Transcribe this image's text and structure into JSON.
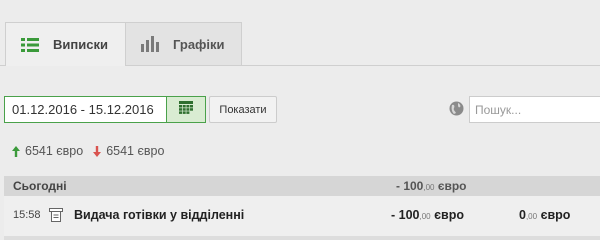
{
  "tabs": [
    {
      "label": "Виписки",
      "active": true
    },
    {
      "label": "Графіки",
      "active": false
    }
  ],
  "filters": {
    "date_range": "01.12.2016 - 15.12.2016",
    "show_label": "Показати",
    "search_placeholder": "Пошук..."
  },
  "summary": {
    "income": "6541 євро",
    "expense": "6541 євро"
  },
  "day": {
    "label": "Сьогодні",
    "total_int": "- 100",
    "total_cents": ",00",
    "total_currency": "євро"
  },
  "transactions": [
    {
      "time": "15:58",
      "description": "Видача готівки у відділенні",
      "amount_int": "- 100",
      "amount_cents": ",00",
      "amount_currency": "євро",
      "balance_int": "0",
      "balance_cents": ",00",
      "balance_currency": "євро"
    }
  ],
  "colors": {
    "accent_green": "#4aa14a",
    "income_arrow": "#3b9a3b",
    "expense_arrow": "#d9534f"
  },
  "icons": {
    "statements_tab": "list-icon",
    "charts_tab": "bar-chart-icon",
    "calendar": "calendar-icon",
    "search": "globe-icon",
    "income": "arrow-up-icon",
    "expense": "arrow-down-icon",
    "transaction": "atm-icon"
  }
}
